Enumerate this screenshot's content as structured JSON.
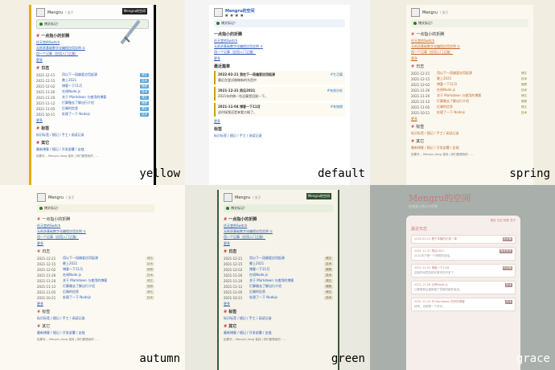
{
  "site": {
    "name": "Mengru",
    "nav_sep": "/ 关于",
    "default_name": "Mengru的空间",
    "notice": "博文标记！",
    "footer": "如果写... Mengru-Jiang 保持 | 你们都是我的 - ..."
  },
  "badges": {
    "yellow": "Mengru的空间",
    "green": "Mengru的空间"
  },
  "themes": {
    "yellow": "yellow",
    "default": "default",
    "spring": "spring",
    "autumn": "autumn",
    "green": "green",
    "grace": "grace"
  },
  "sections": {
    "featured": "一点指小的折腾",
    "log": "日志",
    "tags": "标签",
    "other": "其它",
    "recent": "最近篇章",
    "tag_label": "标签"
  },
  "featured_links": [
    "任天堂的Switch",
    "无纸质基础数字化编程应用实例 ①",
    "用一个记事（应用入门之路）"
  ],
  "more": "更多",
  "log_rows": [
    {
      "date": "2021-12-21",
      "title": "用以下一段偏爱应用起源",
      "tag": "博文"
    },
    {
      "date": "2021-12-15",
      "title": "晚上2021",
      "tag": "技术"
    },
    {
      "date": "2021-12-02",
      "title": "博客一下11月",
      "tag": "随想"
    },
    {
      "date": "2021-11-26",
      "title": "在线Node.js",
      "tag": "技术"
    },
    {
      "date": "2021-11-20",
      "title": "关于 Markdown 与使用的博客",
      "tag": "博文"
    },
    {
      "date": "2021-11-12",
      "title": "打算撤去了解出行介绍",
      "tag": "随想"
    },
    {
      "date": "2021-11-05",
      "title": "后端的信息",
      "tag": "博文"
    },
    {
      "date": "2021-10-21",
      "title": "处理了一下 Nodejs",
      "tag": "技术"
    }
  ],
  "tag_links": "标识标签 / 随记 / 手工 / 阅读记录",
  "other_links": "最新博客 / 随记 / 开发部署 / 友链",
  "default_cards": [
    {
      "date": "2022-02-21",
      "title": "我在下一段偏爱应用起源",
      "tag": "#生活篇",
      "body": "最近在尝试做做新的东西中"
    },
    {
      "date": "2021-12-31",
      "title": "再见2021",
      "tag": "#有效分析",
      "body": "2021年的做一些还算是回顾一下。"
    },
    {
      "date": "2021-11-04",
      "title": "博客一下11月",
      "tag": "#有效期",
      "body": "这时候我还是来看大概了。"
    }
  ],
  "grace": {
    "title": "Mengru的空间",
    "subtitle": "在纸面上的小小世界",
    "nav": "首页  日志  标签  关于",
    "head": "最近日志",
    "cards": [
      {
        "date": "2022-02-21",
        "title": "基于本篇的记录一周",
        "tag": "技术篇",
        "body": ""
      },
      {
        "date": "2021-12-31",
        "title": "再见2021",
        "tag": "有效思考",
        "body": "2021年只是一个简短的总结。"
      },
      {
        "date": "2021-12-01",
        "title": "博客一下11月",
        "tag": "有效期",
        "body": "这段时间里真的好像写的不多了。"
      },
      {
        "date": "2021-11-26",
        "title": "迁移Node.js",
        "tag": "技术",
        "body": "迁移更新后重新做了些新的组件用法。"
      },
      {
        "date": "2021-11-24",
        "title": "写 Markdown 的好的博客",
        "tag": "技术",
        "body": "好吧，也都是一个写字。"
      }
    ]
  }
}
